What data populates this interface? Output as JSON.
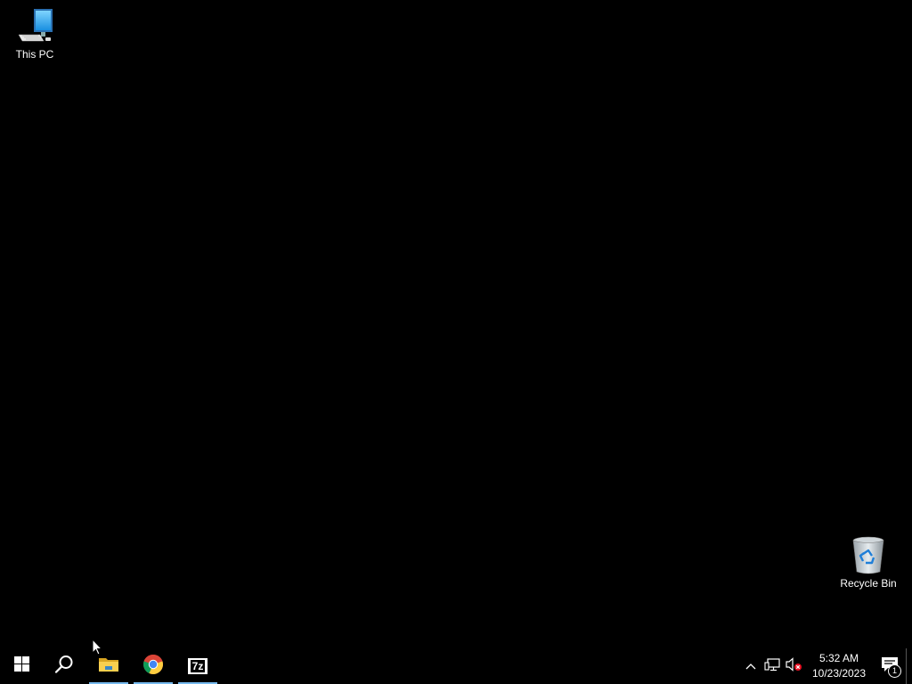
{
  "desktop": {
    "background_color": "#000000",
    "icons": [
      {
        "label": "This PC",
        "icon": "computer-icon"
      },
      {
        "label": "Recycle Bin",
        "icon": "recycle-bin-icon"
      }
    ]
  },
  "taskbar": {
    "background_color": "#000000",
    "start": {
      "icon": "windows-logo-icon"
    },
    "search": {
      "icon": "search-icon"
    },
    "pinned_apps": [
      {
        "name": "File Explorer",
        "icon": "folder-icon",
        "running": true
      },
      {
        "name": "Google Chrome",
        "icon": "chrome-icon",
        "running": true
      },
      {
        "name": "7-Zip",
        "icon": "7zip-icon",
        "icon_text": "7z",
        "running": true
      }
    ],
    "running_indicator_color": "#76b9ed",
    "tray": {
      "overflow_icon": "chevron-up-icon",
      "network_icon": "network-icon",
      "volume_icon": "volume-muted-icon",
      "time": "5:32 AM",
      "date": "10/23/2023",
      "notifications_icon": "action-center-icon",
      "notification_count": "1"
    }
  }
}
